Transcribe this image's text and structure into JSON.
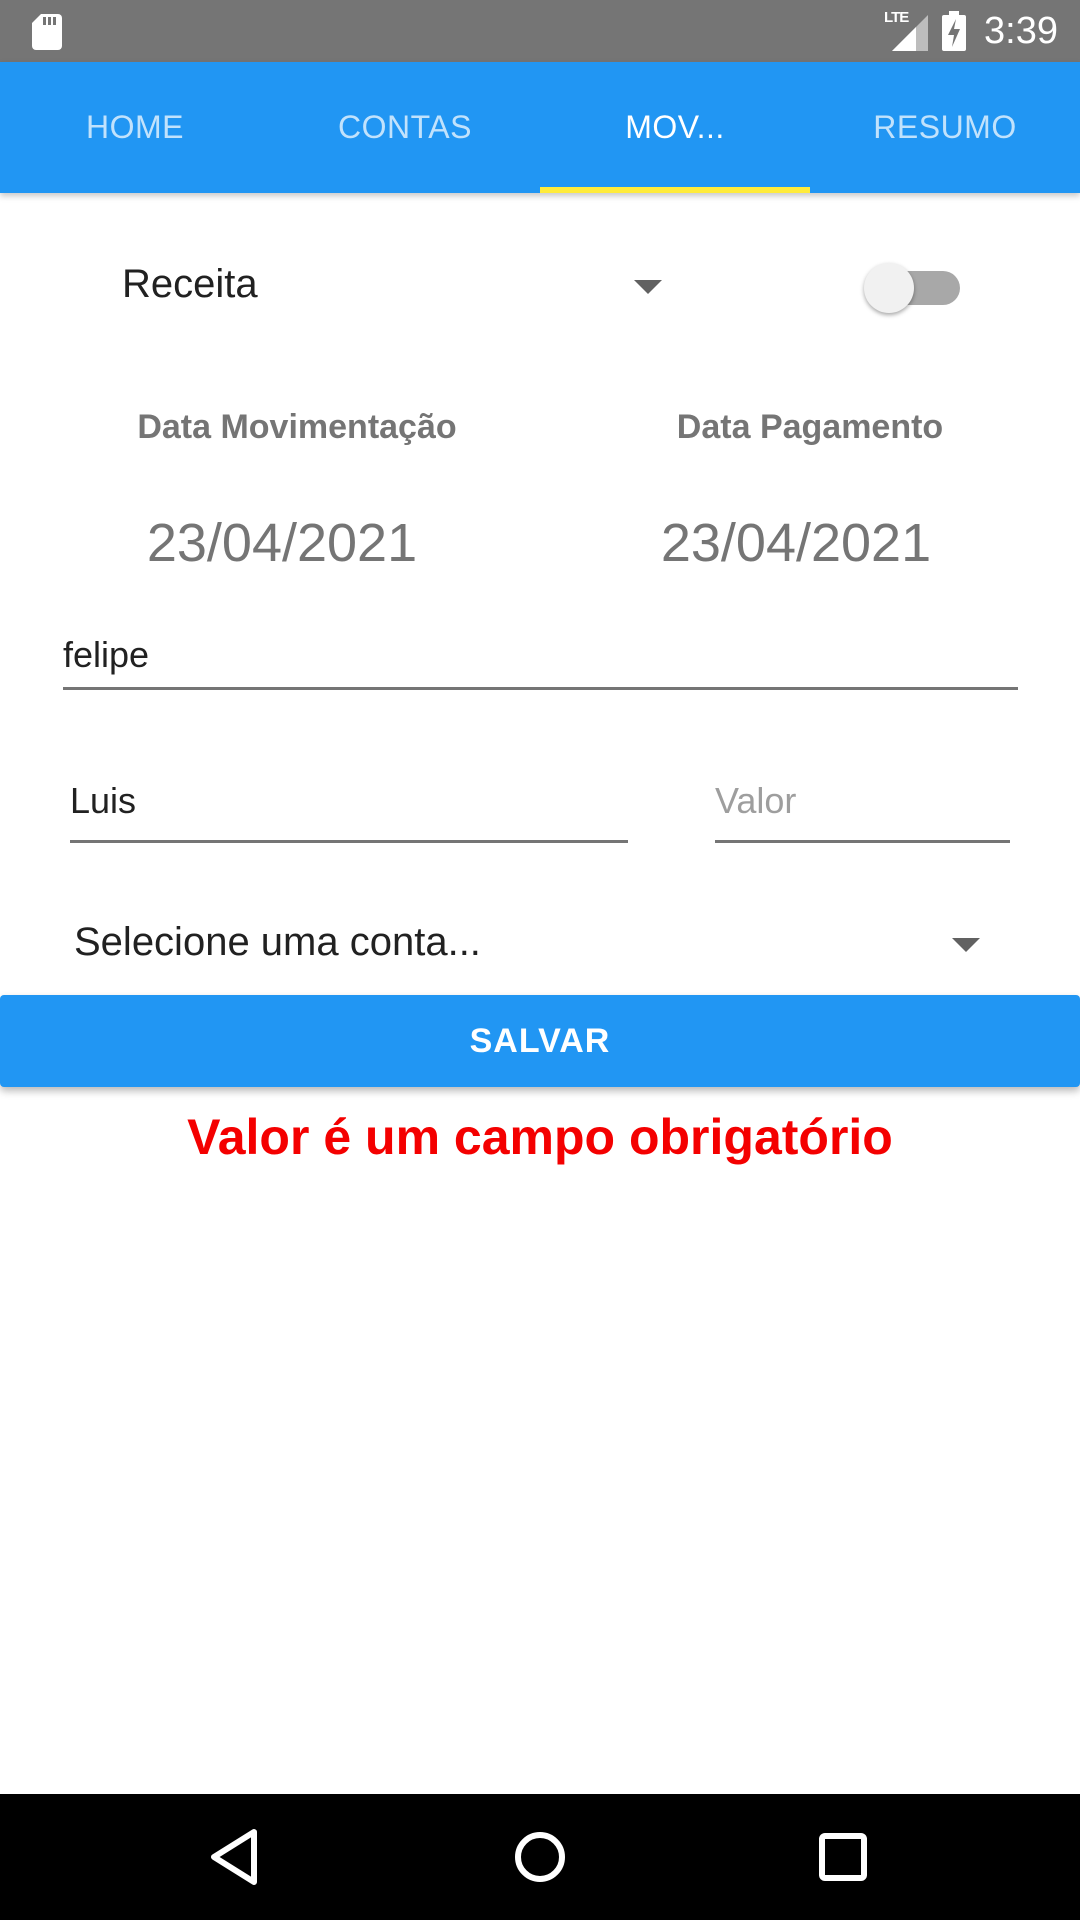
{
  "status_bar": {
    "time": "3:39",
    "network": "LTE",
    "icons": [
      "sd-card-icon",
      "signal-icon",
      "battery-charging-icon"
    ]
  },
  "tabs": [
    {
      "label": "HOME",
      "active": false
    },
    {
      "label": "CONTAS",
      "active": false
    },
    {
      "label": "MOV...",
      "active": true
    },
    {
      "label": "RESUMO",
      "active": false
    }
  ],
  "form": {
    "type_select": {
      "value": "Receita"
    },
    "toggle": {
      "on": false
    },
    "date_movimentacao": {
      "label": "Data Movimentação",
      "value": "23/04/2021"
    },
    "date_pagamento": {
      "label": "Data Pagamento",
      "value": "23/04/2021"
    },
    "description": {
      "value": "felipe"
    },
    "person": {
      "value": "Luis"
    },
    "amount": {
      "value": "",
      "placeholder": "Valor"
    },
    "account_select": {
      "value": "Selecione uma conta..."
    },
    "save_label": "SALVAR",
    "error_message": "Valor é um campo obrigatório"
  },
  "colors": {
    "app_bar": "#2196f3",
    "tab_indicator": "#ffeb3b",
    "error": "#f40000",
    "status_bar": "#757575"
  },
  "nav_bar": {
    "icons": [
      "back-icon",
      "home-icon",
      "recents-icon"
    ]
  }
}
